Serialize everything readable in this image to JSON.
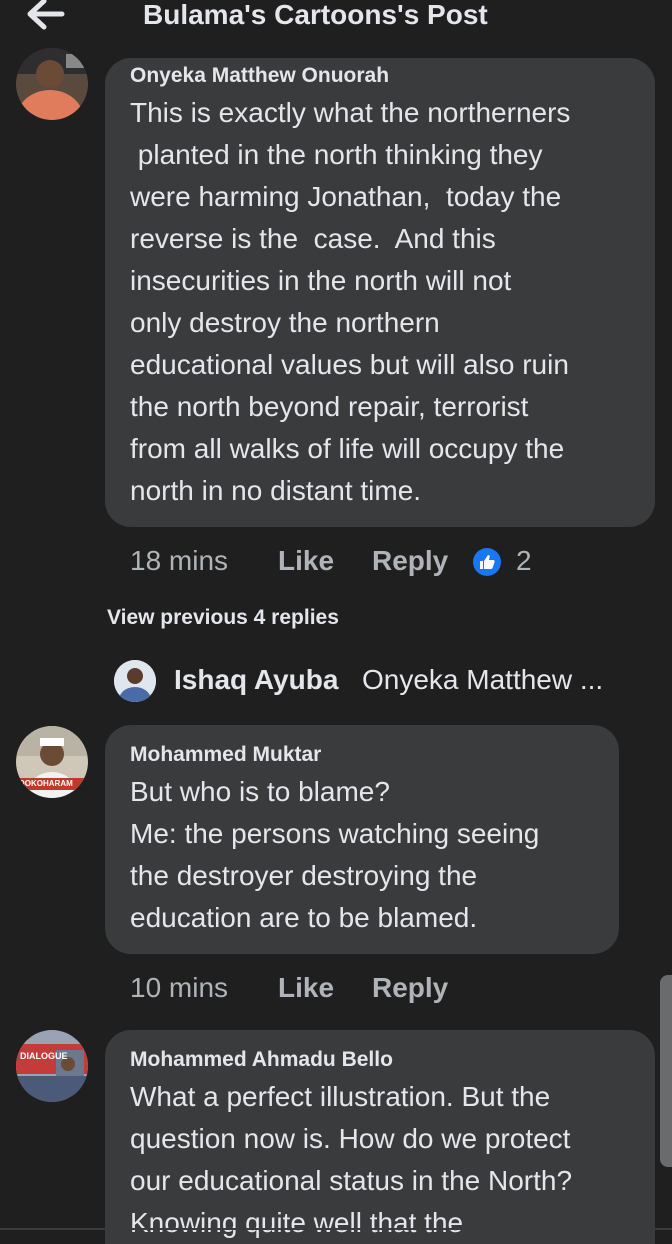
{
  "header": {
    "title": "Bulama's Cartoons's Post"
  },
  "comments": [
    {
      "author": "Onyeka Matthew Onuorah",
      "lines": [
        "This is exactly what the northerners",
        " planted in the north thinking they",
        "were harming Jonathan,  today the",
        "reverse is the  case.  And this",
        "insecurities in the north will not",
        "only destroy the northern",
        "educational values but will also ruin",
        "the north beyond repair, terrorist",
        "from all walks of life will occupy the",
        "north in no distant time."
      ],
      "time": "18 mins",
      "like_label": "Like",
      "reply_label": "Reply",
      "reaction_count": "2"
    },
    {
      "author": "Mohammed Muktar",
      "avatar_text": "DOKOHARAM",
      "lines": [
        "But who is to blame?",
        "Me: the persons watching seeing",
        "the destroyer destroying the",
        "education are to be blamed."
      ],
      "time": "10 mins",
      "like_label": "Like",
      "reply_label": "Reply"
    },
    {
      "author": "Mohammed Ahmadu Bello",
      "avatar_text": "DIALOGUE",
      "lines": [
        "What a perfect illustration. But the",
        "question now is. How do we protect",
        "our educational status in the North?",
        "Knowing quite well that the"
      ]
    }
  ],
  "view_previous": "View previous 4 replies",
  "reply_preview": {
    "name": "Ishaq Ayuba",
    "snippet": "Onyeka Matthew ..."
  },
  "colors": {
    "background": "#1f1f20",
    "bubble": "#3a3b3c",
    "text": "#e4e6eb",
    "muted": "#b0b3b8",
    "like_blue": "#1877f2"
  }
}
